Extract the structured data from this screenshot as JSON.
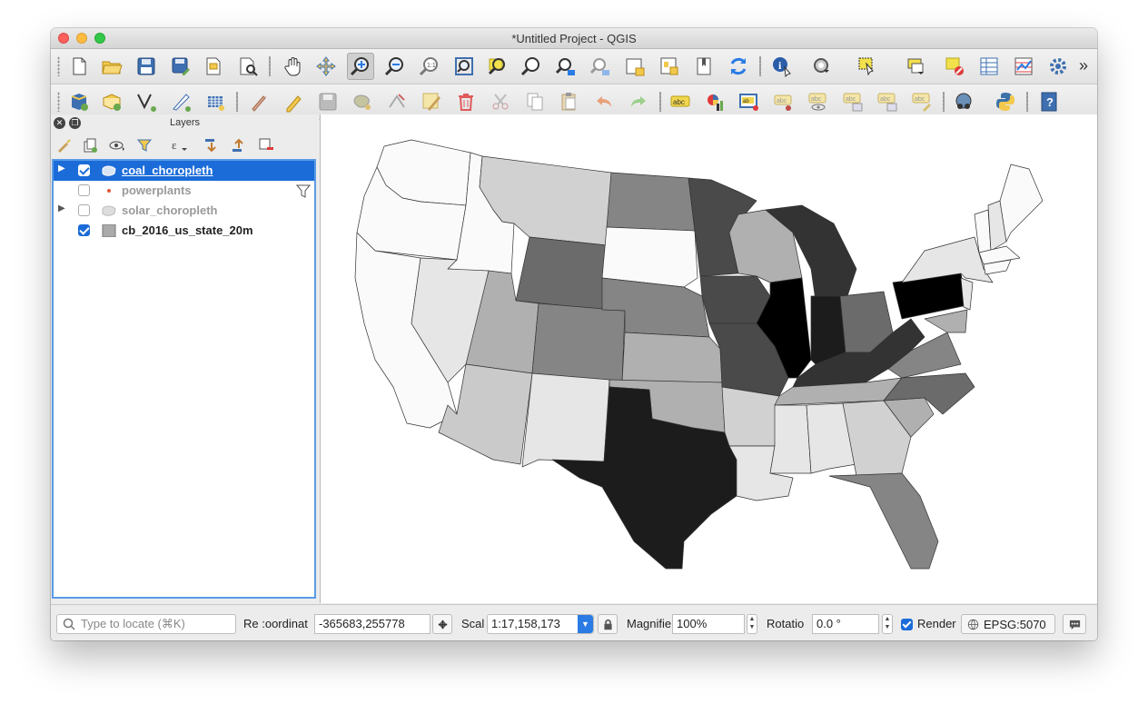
{
  "window": {
    "title": "*Untitled Project - QGIS"
  },
  "toolbar_top": {
    "icons": [
      "new-project",
      "open-project",
      "save-project",
      "save-as",
      "new-print-layout",
      "layout-manager",
      "pan",
      "pan-to-selection",
      "zoom-in",
      "zoom-out",
      "zoom-native",
      "zoom-full",
      "zoom-to-selection",
      "zoom-to-layer",
      "zoom-last",
      "zoom-next",
      "new-map-view",
      "new-3d-view",
      "show-bookmarks",
      "refresh",
      "identify",
      "measure",
      "select-features",
      "attribute-table-tools",
      "deselect",
      "open-attribute-table",
      "statistics",
      "settings"
    ],
    "overflow": "»"
  },
  "toolbar_second": {
    "icons": [
      "add-vector-layer",
      "add-raster-layer",
      "new-shapefile",
      "digitize",
      "add-layer",
      "current-edits",
      "toggle-editing",
      "save-edits",
      "add-feature",
      "vertex-tool",
      "modify-attributes",
      "delete-selected",
      "cut",
      "copy",
      "paste",
      "undo",
      "redo",
      "label-tool",
      "diagram",
      "layer-labeling",
      "pin-labels",
      "show-hide-labels",
      "move-label",
      "rotate-label",
      "change-label",
      "python",
      "help"
    ]
  },
  "layers_panel": {
    "title": "Layers",
    "tools": [
      "style-icon",
      "add-group-icon",
      "visibility-icon",
      "filter-icon",
      "expression-filter-icon",
      "expand-icon",
      "collapse-icon",
      "remove-layer-icon"
    ],
    "layers": [
      {
        "name": "coal_choropleth",
        "checked": true,
        "selected": true,
        "expandable": true,
        "type": "polygon"
      },
      {
        "name": "powerplants",
        "checked": false,
        "selected": false,
        "expandable": false,
        "type": "point",
        "filtered": true
      },
      {
        "name": "solar_choropleth",
        "checked": false,
        "selected": false,
        "expandable": true,
        "type": "polygon"
      },
      {
        "name": "cb_2016_us_state_20m",
        "checked": true,
        "selected": false,
        "expandable": false,
        "type": "fill"
      }
    ]
  },
  "status_bar": {
    "locate_placeholder": "Type to locate (⌘K)",
    "coordinate_label": "Re :oordinat",
    "coordinate_value": "-365683,255778",
    "scale_label": "Scal",
    "scale_value": "1:17,158,173",
    "magnifier_label": "Magnifie",
    "magnifier_value": "100%",
    "rotation_label": "Rotatio",
    "rotation_value": "0.0 °",
    "render_label": "Render",
    "render_checked": true,
    "crs": "EPSG:5070"
  },
  "map": {
    "description_colors": {
      "darkest": "#000000",
      "dark": "#1c1c1c",
      "mid_dark": "#4a4a4a",
      "mid": "#808080",
      "light": "#c8c8c8",
      "lightest": "#fafafa"
    }
  }
}
